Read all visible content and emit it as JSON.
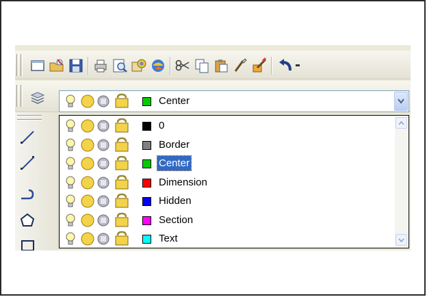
{
  "toolbar_standard": {
    "icons": [
      "new-icon",
      "open-icon",
      "save-icon",
      "plot-icon",
      "plot-preview-icon",
      "publish-icon",
      "3d-dwf-icon",
      "cut-icon",
      "copy-icon",
      "paste-icon",
      "match-properties-icon",
      "block-editor-icon",
      "undo-icon"
    ]
  },
  "layer_toolbar": {
    "icon": "layer-manager-icon",
    "current_layer": {
      "name": "Center",
      "color": "#00cc00"
    }
  },
  "layer_dropdown": {
    "items": [
      {
        "name": "0",
        "color": "#000000",
        "selected": false
      },
      {
        "name": "Border",
        "color": "#808080",
        "selected": false
      },
      {
        "name": "Center",
        "color": "#00cc00",
        "selected": true
      },
      {
        "name": "Dimension",
        "color": "#ff0000",
        "selected": false
      },
      {
        "name": "Hidden",
        "color": "#0000ff",
        "selected": false
      },
      {
        "name": "Section",
        "color": "#ff00ff",
        "selected": false
      },
      {
        "name": "Text",
        "color": "#00ffff",
        "selected": false
      }
    ]
  },
  "draw_toolbar": {
    "icons": [
      "line-icon",
      "construction-line-icon",
      "polyline-icon",
      "polygon-icon",
      "rectangle-icon"
    ]
  },
  "colors": {
    "selection": "#316ac5",
    "lightbulb": "#f6d000",
    "sun": "#f2d34a"
  }
}
